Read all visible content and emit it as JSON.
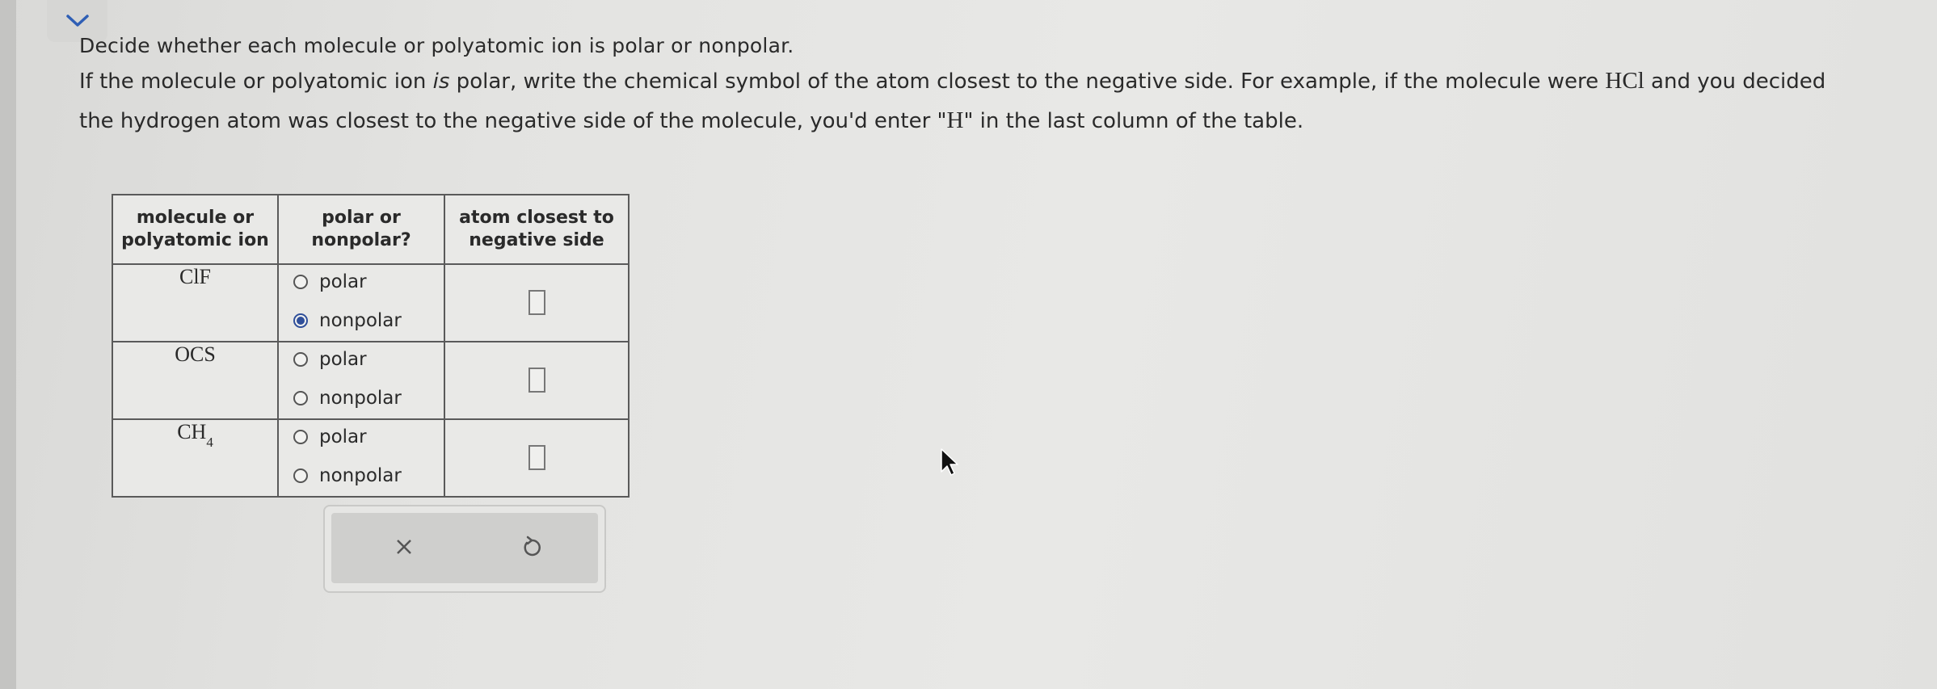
{
  "toggle": {
    "icon": "chevron-down-icon"
  },
  "prompt": {
    "line1": "Decide whether each molecule or polyatomic ion is polar or nonpolar.",
    "p_a": "If the molecule or polyatomic ion ",
    "p_is": "is",
    "p_b": " polar, write the chemical symbol of the atom closest to the negative side. For example, if the molecule were ",
    "example_formula": "HCl",
    "p_c": " and you decided the hydrogen atom was closest to the negative side of the molecule, you'd enter \"",
    "example_answer": "H",
    "p_d": "\" in the last column of the table."
  },
  "table": {
    "headers": {
      "col1_l1": "molecule or",
      "col1_l2": "polyatomic ion",
      "col2_l1": "polar or",
      "col2_l2": "nonpolar?",
      "col3_l1": "atom closest to",
      "col3_l2": "negative side"
    },
    "rows": [
      {
        "formula": "ClF",
        "sub": "",
        "opt1": "polar",
        "opt2": "nonpolar",
        "selected": "nonpolar",
        "answer": ""
      },
      {
        "formula": "OCS",
        "sub": "",
        "opt1": "polar",
        "opt2": "nonpolar",
        "selected": "",
        "answer": ""
      },
      {
        "formula": "CH",
        "sub": "4",
        "opt1": "polar",
        "opt2": "nonpolar",
        "selected": "",
        "answer": ""
      }
    ]
  },
  "actions": {
    "clear_icon": "close-icon",
    "undo_icon": "undo-icon"
  },
  "colors": {
    "selected_radio": "#2f4f9a",
    "panel": "#cfcfcd"
  }
}
